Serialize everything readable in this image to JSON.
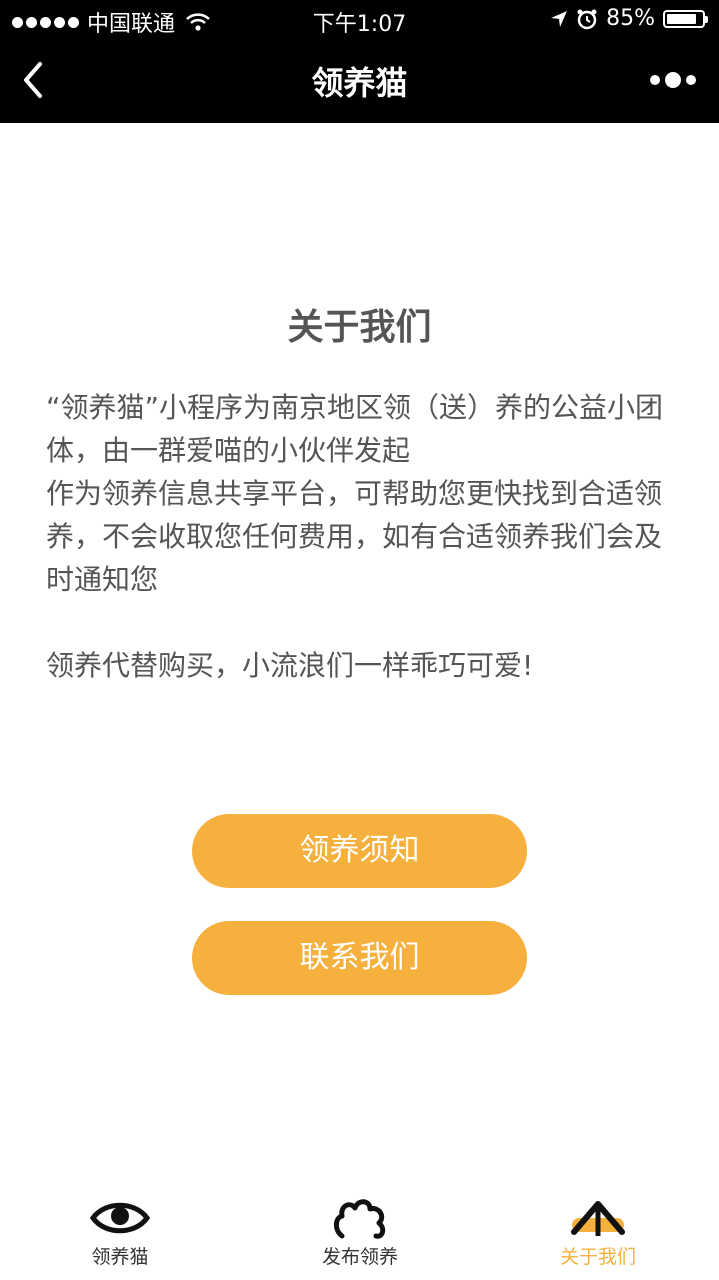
{
  "status_bar": {
    "carrier": "中国联通",
    "time": "下午1:07",
    "battery_percent": "85%",
    "battery_level": 0.85
  },
  "nav": {
    "title": "领养猫",
    "back_icon": "chevron-left-icon",
    "more_icon": "more-dots-icon"
  },
  "about": {
    "title": "关于我们",
    "paragraph1": "“领养猫”小程序为南京地区领（送）养的公益小团体，由一群爱喵的小伙伴发起",
    "paragraph2": "作为领养信息共享平台，可帮助您更快找到合适领养，不会收取您任何费用，如有合适领养我们会及时通知您",
    "paragraph3": "领养代替购买，小流浪们一样乖巧可爱!"
  },
  "buttons": {
    "notice": "领养须知",
    "contact": "联系我们"
  },
  "tabbar": {
    "items": [
      {
        "label": "领养猫",
        "icon": "eye-icon",
        "active": false
      },
      {
        "label": "发布领养",
        "icon": "paw-icon",
        "active": false
      },
      {
        "label": "关于我们",
        "icon": "home-icon",
        "active": true
      }
    ]
  },
  "colors": {
    "accent": "#f6b03d",
    "nav_background": "#000000",
    "text": "#555555"
  }
}
